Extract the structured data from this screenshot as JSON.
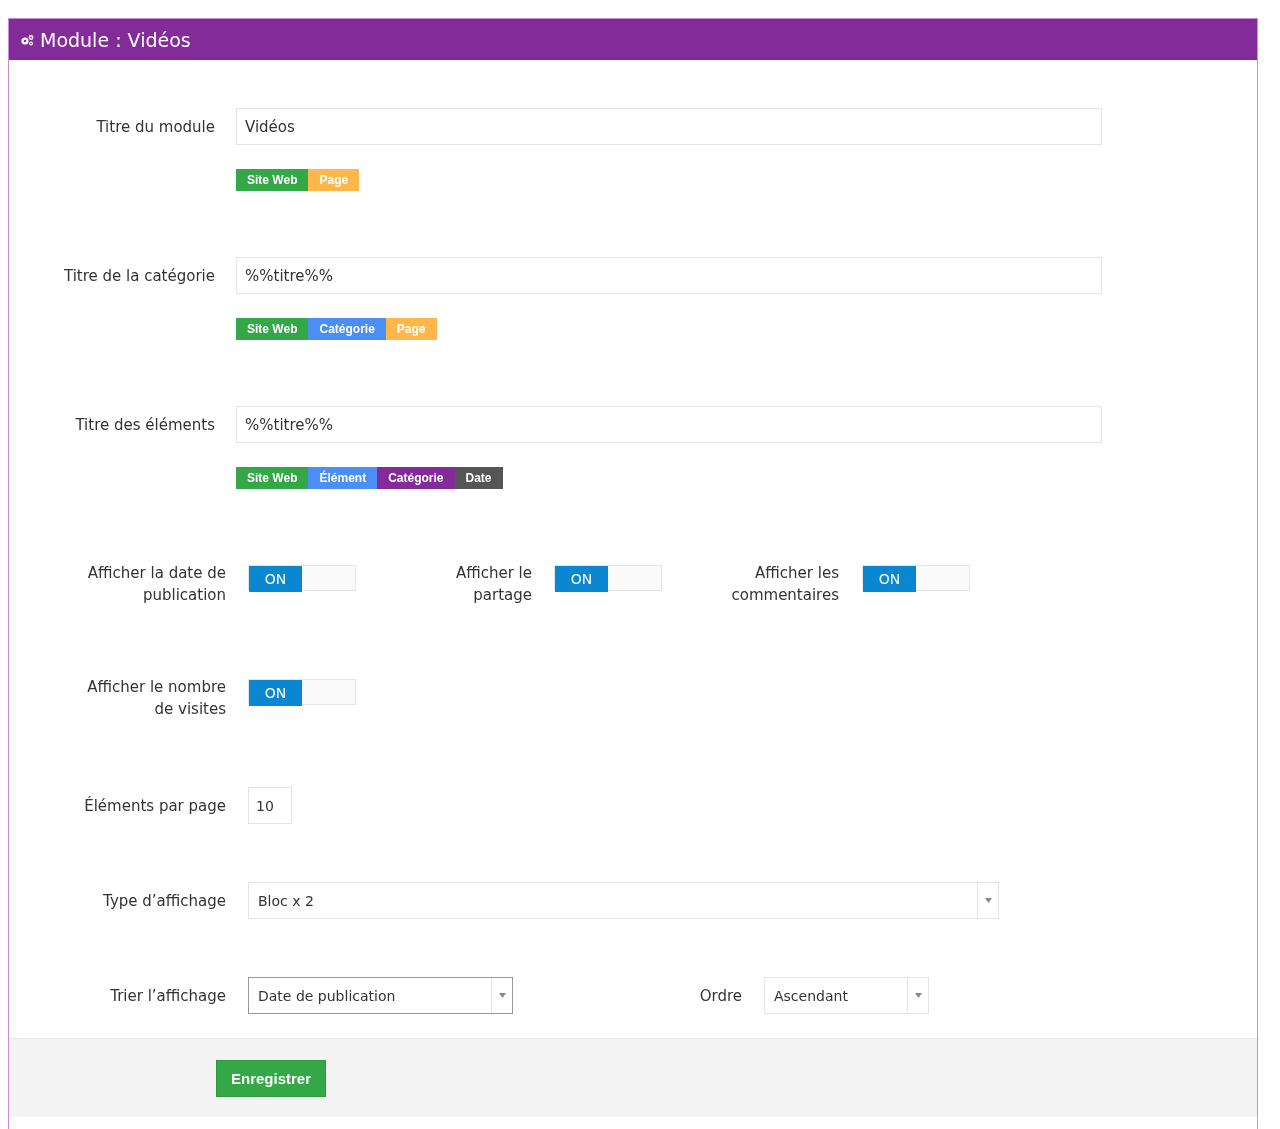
{
  "panel": {
    "title": "Module : Vidéos"
  },
  "title_fields": [
    {
      "label": "Titre du module",
      "value": "Vidéos",
      "tags": [
        {
          "text": "Site Web",
          "color": "#34a846"
        },
        {
          "text": "Page",
          "color": "#ffb64a"
        }
      ]
    },
    {
      "label": "Titre de la catégorie",
      "value": "%%titre%%",
      "tags": [
        {
          "text": "Site Web",
          "color": "#34a846"
        },
        {
          "text": "Catégorie",
          "color": "#4b8ef5"
        },
        {
          "text": "Page",
          "color": "#ffb64a"
        }
      ]
    },
    {
      "label": "Titre des éléments",
      "value": "%%titre%%",
      "tags": [
        {
          "text": "Site Web",
          "color": "#34a846"
        },
        {
          "text": "Élément",
          "color": "#4b8ef5"
        },
        {
          "text": "Catégorie",
          "color": "#842b9a"
        },
        {
          "text": "Date",
          "color": "#555555"
        }
      ]
    }
  ],
  "switch_rows": [
    [
      {
        "label": "Afficher la date de publication",
        "on": true,
        "state_text": "ON"
      },
      {
        "label": "Afficher le partage",
        "on": true,
        "state_text": "ON"
      },
      {
        "label": "Afficher les commentaires",
        "on": true,
        "state_text": "ON"
      }
    ],
    [
      {
        "label": "Afficher le nombre de visites",
        "on": true,
        "state_text": "ON"
      }
    ]
  ],
  "per_page": {
    "label": "Éléments par page",
    "value": "10"
  },
  "display_type": {
    "label": "Type d’affichage",
    "value": "Bloc x 2",
    "focused": false
  },
  "sort": {
    "label": "Trier l’affichage",
    "value": "Date de publication",
    "focused": true
  },
  "order": {
    "label": "Ordre",
    "value": "Ascendant",
    "focused": false
  },
  "save_button": "Enregistrer"
}
